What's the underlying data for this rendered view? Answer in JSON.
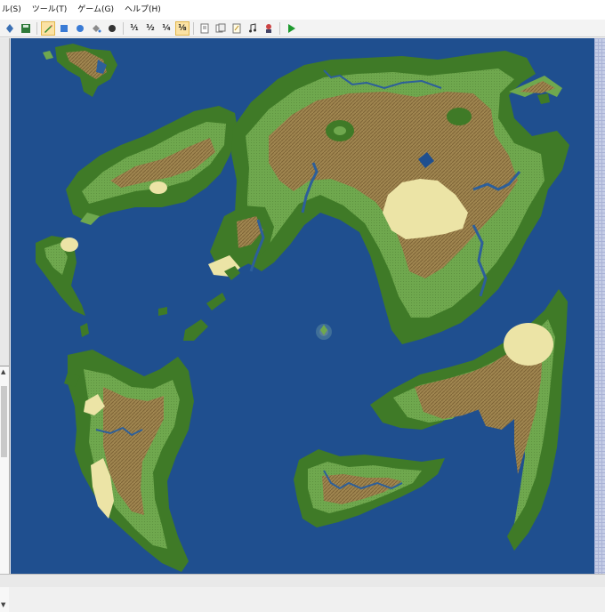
{
  "menubar": {
    "items": [
      "ル(S)",
      "ツール(T)",
      "ゲーム(G)",
      "ヘルプ(H)"
    ]
  },
  "toolbar": {
    "fractions": [
      "¹⁄₁",
      "¹⁄₂",
      "¹⁄₄",
      "¹⁄₈"
    ],
    "icons": [
      "layer-icon",
      "save-icon",
      "pencil-icon",
      "rectangle-icon",
      "ellipse-icon",
      "fill-icon",
      "shadow-icon",
      "fraction-1-1",
      "fraction-1-2",
      "fraction-1-4",
      "fraction-1-8",
      "database-icon",
      "resource-icon",
      "script-icon",
      "sound-icon",
      "character-icon",
      "play-icon"
    ]
  },
  "colors": {
    "ocean": "#1f4f8f",
    "grass": "#6fa84e",
    "forest": "#3f7a27",
    "hills": "#9a8a4a",
    "mountain": "#8b6b3e",
    "desert": "#ece4a6",
    "river": "#2d5f9a"
  }
}
